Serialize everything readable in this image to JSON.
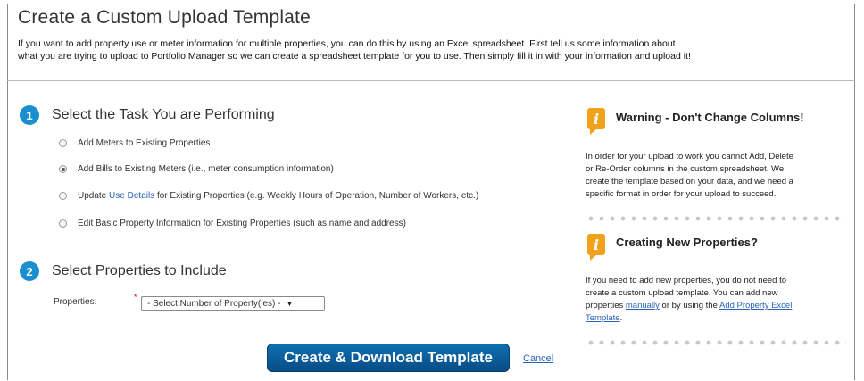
{
  "page": {
    "title": "Create a Custom Upload Template",
    "intro_line1": "If you want to add property use or meter information for multiple properties, you can do this by using an Excel spreadsheet. First tell us some information about",
    "intro_line2": "what you are trying to upload to Portfolio Manager so we can create a spreadsheet template for you to use. Then simply fill it in with your information and upload it!"
  },
  "step1": {
    "number": "1",
    "title": "Select the Task You are Performing",
    "options": [
      {
        "label": "Add Meters to Existing Properties",
        "checked": false
      },
      {
        "label": "Add Bills to Existing Meters (i.e., meter consumption information)",
        "checked": true
      },
      {
        "label_pre": "Update ",
        "link": "Use Details",
        "label_post": " for Existing Properties (e.g. Weekly Hours of Operation, Number of Workers, etc.)",
        "checked": false
      },
      {
        "label": "Edit Basic Property Information for Existing Properties (such as name and address)",
        "checked": false
      }
    ]
  },
  "step2": {
    "number": "2",
    "title": "Select Properties to Include",
    "field_label": "Properties:",
    "required_mark": "*",
    "select_value": "- Select Number of Property(ies) -",
    "select_arrow": "▼"
  },
  "actions": {
    "create_label": "Create & Download Template",
    "cancel_label": "Cancel"
  },
  "sidebar": {
    "icon_glyph": "i",
    "warning": {
      "title": "Warning - Don't Change Columns!",
      "lines": [
        "In order for your upload to work you cannot Add, Delete",
        "or Re-Order columns in the custom spreadsheet. We",
        "create the template based on your data, and we need a",
        "specific format in order for your upload to succeed."
      ]
    },
    "new_props": {
      "title": "Creating New Properties?",
      "line1": "If you need to add new properties, you do not need to",
      "line2": "create a custom upload template. You can add new",
      "line3_pre": "properties ",
      "link_manual": "manually",
      "line3_mid": " or by using the ",
      "link_template_1": "Add Property Excel",
      "link_template_2": "Template",
      "line4_post": "."
    }
  }
}
